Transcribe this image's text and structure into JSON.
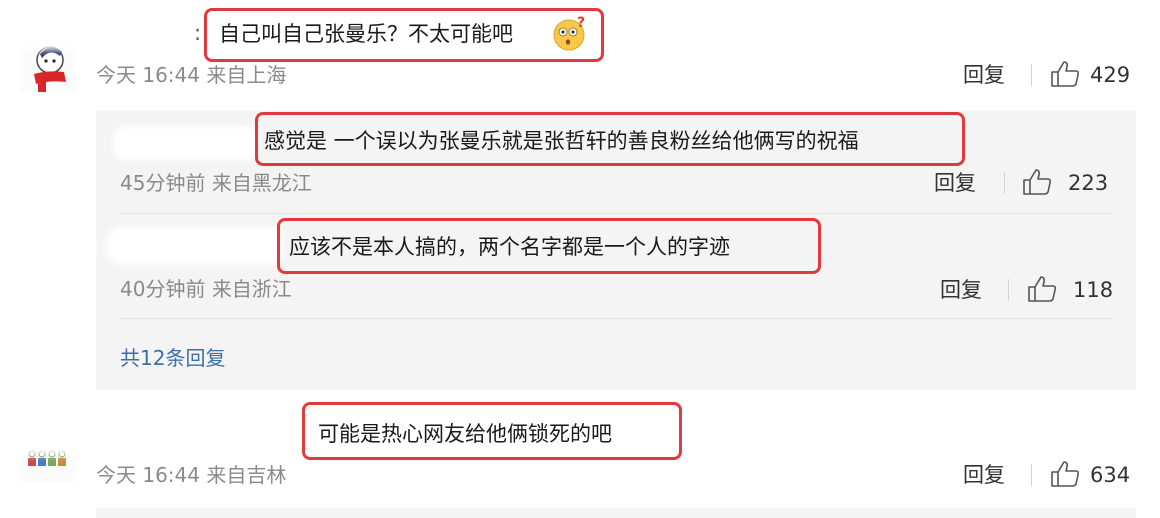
{
  "comments": [
    {
      "text": "自己叫自己张曼乐？不太可能吧",
      "emoji_icon": "thinking-face-emoji",
      "time": "今天 16:44",
      "location": "来自上海",
      "reply_label": "回复",
      "likes": "429",
      "replies": [
        {
          "text": "感觉是 一个误以为张曼乐就是张哲轩的善良粉丝给他俩写的祝福",
          "time": "45分钟前",
          "location": "来自黑龙江",
          "reply_label": "回复",
          "likes": "223"
        },
        {
          "text": "应该不是本人搞的，两个名字都是一个人的字迹",
          "time": "40分钟前",
          "location": "来自浙江",
          "reply_label": "回复",
          "likes": "118"
        }
      ],
      "more_replies": "共12条回复"
    },
    {
      "text": "可能是热心网友给他俩锁死的吧",
      "time": "今天 16:44",
      "location": "来自吉林",
      "reply_label": "回复",
      "likes": "634"
    }
  ],
  "colors": {
    "highlight_box": "#e03a3e",
    "link": "#3b6fa8",
    "meta": "#8a8a8a",
    "panel_bg": "#f4f4f4"
  },
  "icons": {
    "like": "thumbs-up-icon",
    "avatar1": "avatar-red-scarf",
    "avatar2": "avatar-figures"
  }
}
